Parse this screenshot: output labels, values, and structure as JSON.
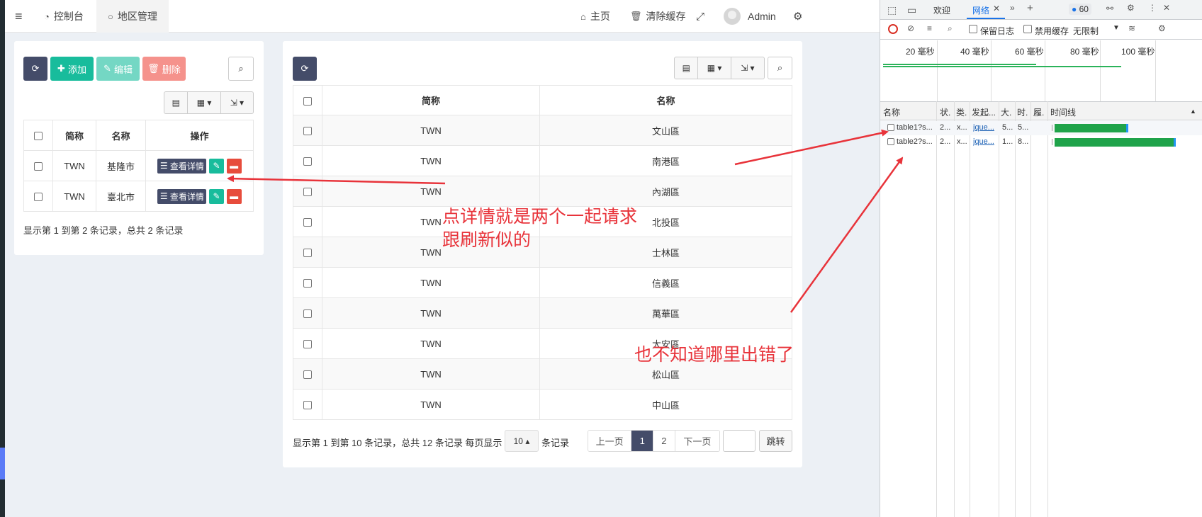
{
  "topnav": {
    "menu_icon": "hamburger-icon",
    "tabs": [
      {
        "label": "控制台",
        "icon": "dashboard-icon"
      },
      {
        "label": "地区管理",
        "icon": "circle-icon"
      }
    ],
    "right": [
      {
        "label": "主页",
        "icon": "home-icon"
      },
      {
        "label": "清除缓存",
        "icon": "trash-icon"
      }
    ],
    "fullscreen_icon": "expand-icon",
    "user": "Admin",
    "settings_icon": "gears-icon"
  },
  "left_panel": {
    "toolbar": {
      "refresh": "",
      "add": "添加",
      "edit": "编辑",
      "delete": "删除"
    },
    "headers": [
      "简称",
      "名称",
      "操作"
    ],
    "rows": [
      {
        "abbr": "TWN",
        "name": "基隆市",
        "detail": "查看详情"
      },
      {
        "abbr": "TWN",
        "name": "臺北市",
        "detail": "查看详情"
      }
    ],
    "info": "显示第 1 到第 2 条记录，总共 2 条记录"
  },
  "right_panel": {
    "headers": [
      "简称",
      "名称"
    ],
    "rows": [
      {
        "abbr": "TWN",
        "name": "文山區"
      },
      {
        "abbr": "TWN",
        "name": "南港區"
      },
      {
        "abbr": "TWN",
        "name": "內湖區"
      },
      {
        "abbr": "TWN",
        "name": "北投區"
      },
      {
        "abbr": "TWN",
        "name": "士林區"
      },
      {
        "abbr": "TWN",
        "name": "信義區"
      },
      {
        "abbr": "TWN",
        "name": "萬華區"
      },
      {
        "abbr": "TWN",
        "name": "大安區"
      },
      {
        "abbr": "TWN",
        "name": "松山區"
      },
      {
        "abbr": "TWN",
        "name": "中山區"
      }
    ],
    "info": "显示第 1 到第 10 条记录，总共 12 条记录 每页显示",
    "page_size": "10",
    "info_suffix": "条记录",
    "pager": {
      "prev": "上一页",
      "pages": [
        "1",
        "2"
      ],
      "next": "下一页",
      "jump": "跳转"
    }
  },
  "devtools": {
    "tabs": [
      "欢迎",
      "网络"
    ],
    "badge": "60",
    "preserve_log": "保留日志",
    "disable_cache": "禁用缓存",
    "throttle": "无限制",
    "timeline_ticks": [
      "20 毫秒",
      "40 毫秒",
      "60 毫秒",
      "80 毫秒",
      "100 毫秒"
    ],
    "columns": [
      "名称",
      "状.",
      "类.",
      "发起...",
      "大.",
      "时.",
      "履.",
      "时间线"
    ],
    "requests": [
      {
        "name": "table1?s...",
        "status": "2...",
        "type": "x...",
        "initiator": "jque...",
        "size": "5...",
        "time": "5..."
      },
      {
        "name": "table2?s...",
        "status": "2...",
        "type": "x...",
        "initiator": "jque...",
        "size": "1...",
        "time": "8..."
      }
    ]
  },
  "annotations": {
    "a1_line1": "点详情就是两个一起请求",
    "a1_line2": "跟刷新似的",
    "a2": "也不知道哪里出错了"
  },
  "colors": {
    "annotation": "#e8333a",
    "primary_dark": "#444c69",
    "success": "#18bc9c",
    "danger": "#e74c3c"
  }
}
